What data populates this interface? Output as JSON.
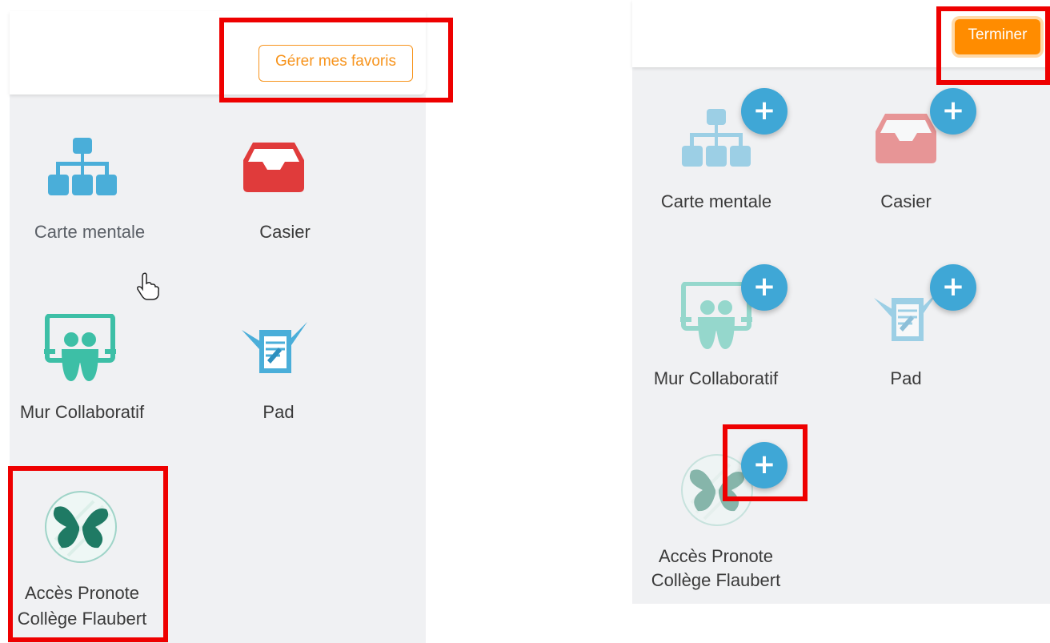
{
  "left_panel": {
    "manage_favorites_label": "Gérer mes favoris",
    "apps": [
      {
        "label": "Carte mentale",
        "icon": "sitemap-icon"
      },
      {
        "label": "Casier",
        "icon": "inbox-tray-icon"
      },
      {
        "label": "Mur Collaboratif",
        "icon": "collaborative-wall-icon"
      },
      {
        "label": "Pad",
        "icon": "pad-icon"
      },
      {
        "label_line1": "Accès Pronote",
        "label_line2": "Collège Flaubert",
        "icon": "butterfly-logo-icon"
      }
    ]
  },
  "right_panel": {
    "finish_label": "Terminer",
    "add_symbol": "+",
    "apps": [
      {
        "label": "Carte mentale",
        "icon": "sitemap-icon"
      },
      {
        "label": "Casier",
        "icon": "inbox-tray-icon"
      },
      {
        "label": "Mur Collaboratif",
        "icon": "collaborative-wall-icon"
      },
      {
        "label": "Pad",
        "icon": "pad-icon"
      },
      {
        "label_line1": "Accès Pronote",
        "label_line2": "Collège Flaubert",
        "icon": "butterfly-logo-icon"
      }
    ]
  },
  "colors": {
    "highlight": "#ee0000",
    "accent_orange": "#ff8c00",
    "add_blue": "#3fa7d6",
    "sitemap_blue": "#4aaed9",
    "casier_red": "#e03b3b",
    "mur_teal": "#3dbfa6",
    "panel_bg": "#f0f1f3"
  }
}
